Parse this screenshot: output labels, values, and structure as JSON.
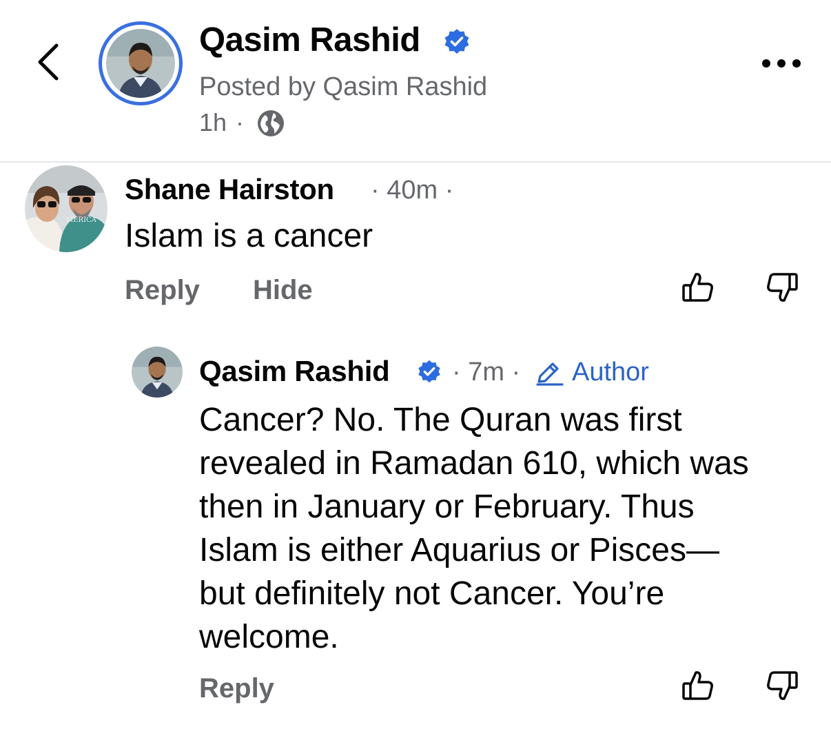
{
  "header": {
    "title": "Qasim Rashid",
    "subtitle": "Posted by Qasim Rashid",
    "time": "1h",
    "dot": "·",
    "icons": [
      "back-chevron-icon",
      "verified-badge-icon",
      "globe-icon",
      "more-icon"
    ]
  },
  "comment": {
    "author": "Shane Hairston",
    "meta": "· 40m ·",
    "text": "Islam is a cancer",
    "reply_label": "Reply",
    "hide_label": "Hide"
  },
  "reply": {
    "author": "Qasim Rashid",
    "meta": "· 7m ·",
    "author_tag": "Author",
    "lines": [
      "Cancer? No. The Quran was first",
      "revealed in Ramadan 610, which was",
      "then in January or February. Thus",
      "Islam is either Aquarius or Pisces—",
      "but definitely not Cancer. You’re",
      "welcome."
    ],
    "reply_label": "Reply"
  },
  "colors": {
    "accent": "#3a6fe0",
    "muted_text": "#65676b",
    "author_tag": "#2a63c8",
    "divider": "#e4e6eb"
  }
}
